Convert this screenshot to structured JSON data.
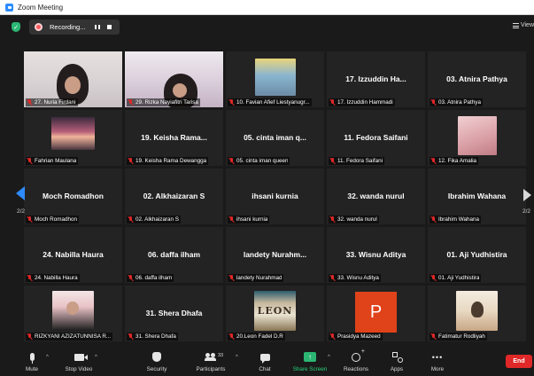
{
  "window": {
    "title": "Zoom Meeting"
  },
  "topbar": {
    "recording_label": "Recording...",
    "view_label": "View"
  },
  "navigation": {
    "left_page": "2/2",
    "right_page": "2/2"
  },
  "tiles": [
    {
      "label": "27. Nuria Firdani",
      "title": ""
    },
    {
      "label": "29. Rizka Nayiafitri Tarisa",
      "title": ""
    },
    {
      "label": "10. Favian Afief Liestyanugr...",
      "title": ""
    },
    {
      "label": "17. Izzuddin Hammadi",
      "title": "17. Izzuddin Ha..."
    },
    {
      "label": "03. Atnira Pathya",
      "title": "03. Atnira Pathya"
    },
    {
      "label": "Fahrian Maulana",
      "title": ""
    },
    {
      "label": "19. Keisha Rama Dewangga",
      "title": "19. Keisha Rama..."
    },
    {
      "label": "05. cinta iman queen",
      "title": "05. cinta iman q..."
    },
    {
      "label": "11. Fedora Saifani",
      "title": "11. Fedora Saifani"
    },
    {
      "label": "12. Fika Amalia",
      "title": ""
    },
    {
      "label": "Moch Romadhon",
      "title": "Moch Romadhon"
    },
    {
      "label": "02. Alkhaizaran S",
      "title": "02. Alkhaizaran S"
    },
    {
      "label": "ihsani kurnia",
      "title": "ihsani kurnia"
    },
    {
      "label": "32. wanda nurul",
      "title": "32. wanda nurul"
    },
    {
      "label": "Ibrahim Wahana",
      "title": "Ibrahim Wahana"
    },
    {
      "label": "24. Nabilla Haura",
      "title": "24. Nabilla Haura"
    },
    {
      "label": "06. daffa ilham",
      "title": "06. daffa ilham"
    },
    {
      "label": "landety Nurahmad",
      "title": "landety Nurahm..."
    },
    {
      "label": "33. Wisnu Aditya",
      "title": "33. Wisnu Aditya"
    },
    {
      "label": "01. Aji Yudhistira",
      "title": "01. Aji Yudhistira"
    },
    {
      "label": "RIZKYANI AZIZATUNNISA R...",
      "title": ""
    },
    {
      "label": "31. Shera Dhafa",
      "title": "31. Shera Dhafa"
    },
    {
      "label": "20.Leon Fadel D.R",
      "title": "",
      "picture_text": "LEON"
    },
    {
      "label": "Prasidya Mazeed",
      "title": "",
      "avatar_letter": "P"
    },
    {
      "label": "Fatimatur Rodliyah",
      "title": ""
    }
  ],
  "toolbar": {
    "mute_label": "Mute",
    "video_label": "Stop Video",
    "security_label": "Security",
    "participants_label": "Participants",
    "participants_count": "33",
    "chat_label": "Chat",
    "share_label": "Share Screen",
    "reactions_label": "Reactions",
    "apps_label": "Apps",
    "more_label": "More",
    "end_label": "End",
    "more_glyph": "•••",
    "caret_glyph": "^",
    "share_glyph": "↑"
  },
  "colors": {
    "accent_blue": "#2d8cff",
    "share_green": "#2bb673",
    "end_red": "#e02828",
    "muted_red": "#e02828",
    "prasidya_avatar": "#e0421a"
  }
}
